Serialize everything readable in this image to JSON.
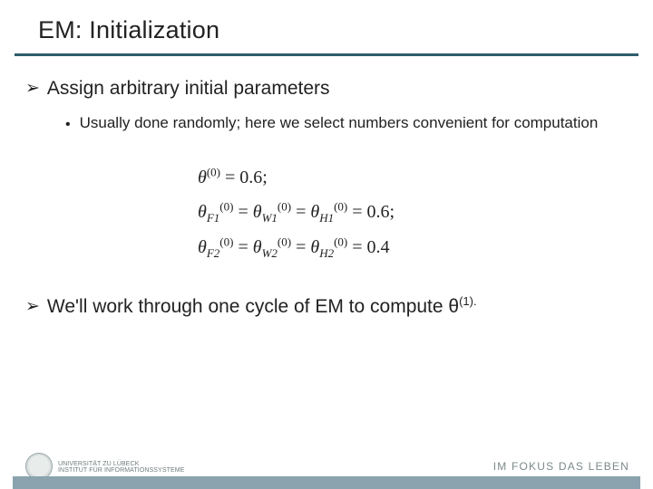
{
  "title": "EM: Initialization",
  "bullet1": "Assign arbitrary initial parameters",
  "bullet2": "Usually done randomly; here we select numbers convenient for computation",
  "eq": {
    "theta0": "0.6",
    "row2_val": "0.6",
    "row3_val": "0.4",
    "sub_F1": "F1",
    "sub_W1": "W1",
    "sub_H1": "H1",
    "sub_F2": "F2",
    "sub_W2": "W2",
    "sub_H2": "H2"
  },
  "bullet3_pre": "We'll work through one cycle of EM to compute θ",
  "bullet3_sup": "(1).",
  "footer": {
    "inst_line1": "UNIVERSITÄT ZU LÜBECK",
    "inst_line2": "INSTITUT FÜR INFORMATIONSSYSTEME",
    "motto": "IM FOKUS DAS LEBEN"
  }
}
